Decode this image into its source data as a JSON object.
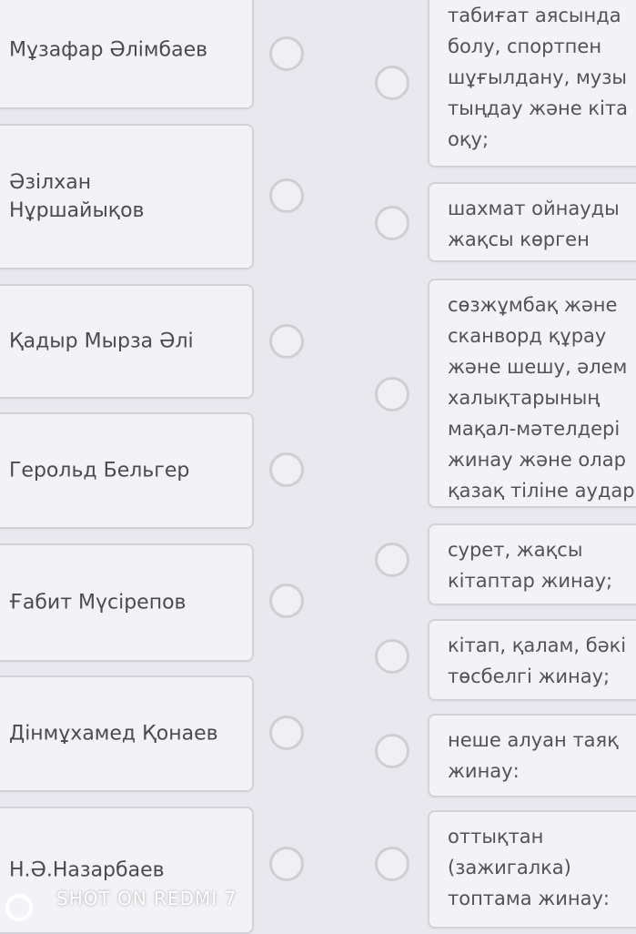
{
  "people": [
    "Мұзафар Әлімбаев",
    "Әзілхан\nНұршайықов",
    "Қадыр Мырза Әлі",
    "Герольд Бельгер",
    "Ғабит Мүсірепов",
    "Дінмұхамед Қонаев",
    "Н.Ә.Назарбаев"
  ],
  "hobbies": [
    "табиғат аясында\nболу, спортпен\nшұғылдану, музы\nтыңдау және кіта\nоқу;",
    "шахмат ойнауды\nжақсы көрген",
    "сөзжұмбақ және\nсканворд құрау\nжәне шешу, әлем\nхалықтарының\nмақал-мәтелдері\nжинау және олар\nқазақ тіліне аудар",
    "сурет, жақсы\nкітаптар жинау;",
    "кітап, қалам, бәкі\nтөсбелгі жинау;",
    "неше алуан таяқ\nжинау:",
    "оттықтан\n(зажигалка)\nтоптама жинау:"
  ],
  "watermark": "SHOT ON REDMI 7"
}
